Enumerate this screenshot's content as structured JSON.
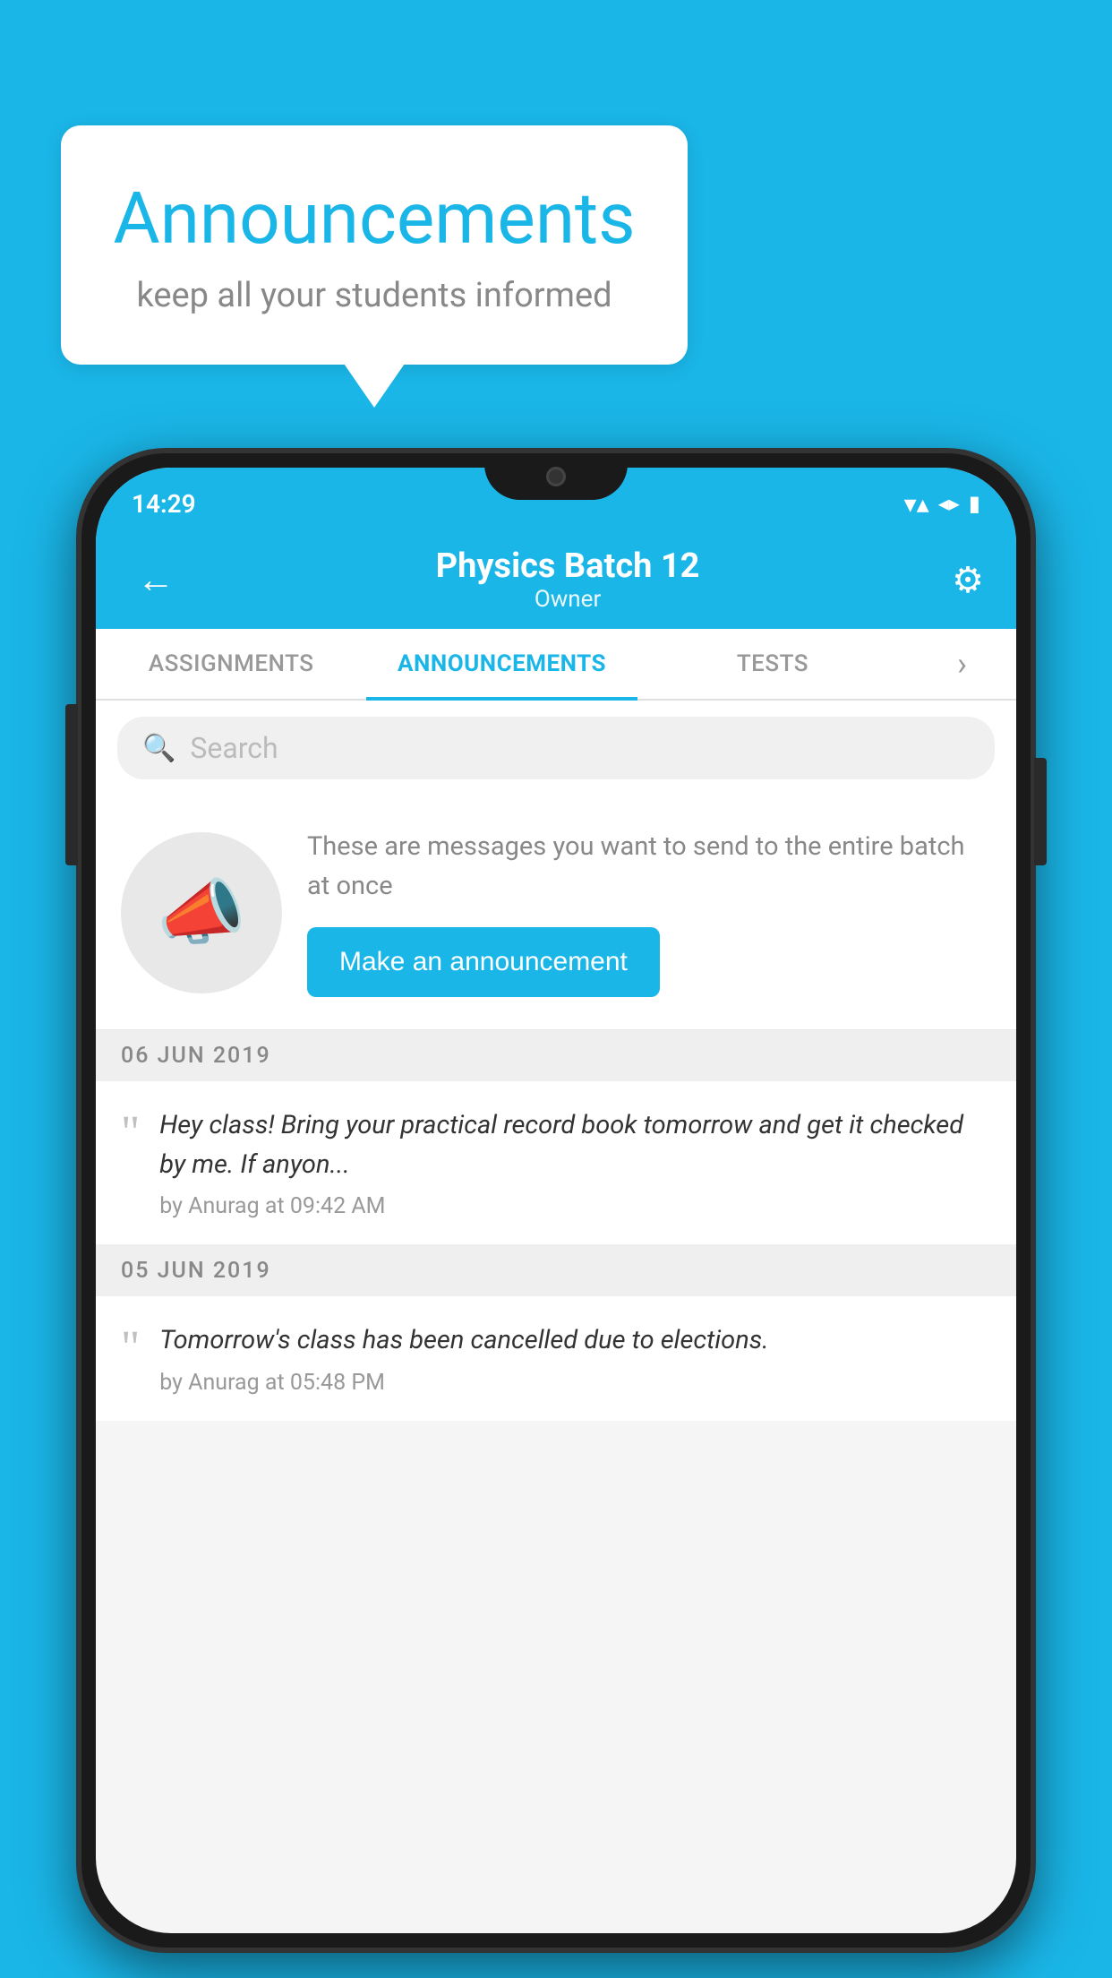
{
  "page": {
    "background_color": "#1ab6e8"
  },
  "speech_bubble": {
    "title": "Announcements",
    "subtitle": "keep all your students informed"
  },
  "status_bar": {
    "time": "14:29",
    "wifi": "▼",
    "signal": "▲",
    "battery": "▮"
  },
  "header": {
    "back_label": "←",
    "title": "Physics Batch 12",
    "subtitle": "Owner",
    "gear_label": "⚙"
  },
  "tabs": [
    {
      "label": "ASSIGNMENTS",
      "active": false
    },
    {
      "label": "ANNOUNCEMENTS",
      "active": true
    },
    {
      "label": "TESTS",
      "active": false
    }
  ],
  "tabs_more": "›",
  "search": {
    "placeholder": "Search"
  },
  "promo": {
    "description": "These are messages you want to send to the entire batch at once",
    "button_label": "Make an announcement"
  },
  "date_groups": [
    {
      "date": "06  JUN  2019",
      "announcements": [
        {
          "text": "Hey class! Bring your practical record book tomorrow and get it checked by me. If anyon...",
          "meta": "by Anurag at 09:42 AM"
        }
      ]
    },
    {
      "date": "05  JUN  2019",
      "announcements": [
        {
          "text": "Tomorrow's class has been cancelled due to elections.",
          "meta": "by Anurag at 05:48 PM"
        }
      ]
    }
  ]
}
